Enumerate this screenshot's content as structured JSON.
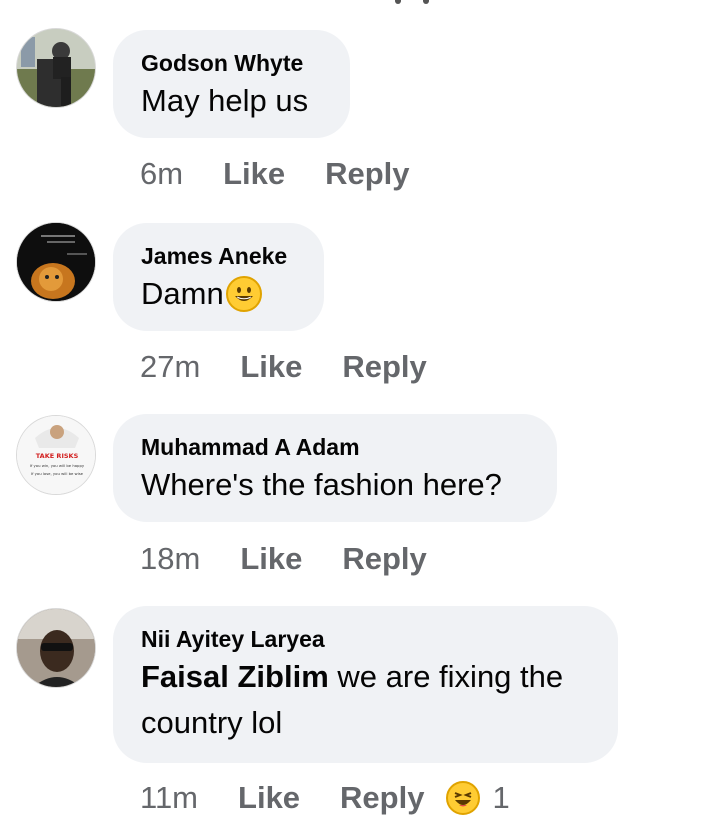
{
  "comments": [
    {
      "author": "Godson Whyte",
      "text": "May help us",
      "time": "6m",
      "like_label": "Like",
      "reply_label": "Reply"
    },
    {
      "author": "James Aneke",
      "text": "Damn",
      "emoji": "grinning-face-emoji",
      "time": "27m",
      "like_label": "Like",
      "reply_label": "Reply"
    },
    {
      "author": "Muhammad A Adam",
      "text": "Where's the fashion here?",
      "avatar_text_1": "TAKE RISKS",
      "avatar_text_2": "If you win, you will be happy",
      "avatar_text_3": "If you lose, you will be wise",
      "time": "18m",
      "like_label": "Like",
      "reply_label": "Reply"
    },
    {
      "author": "Nii Ayitey Laryea",
      "mention": "Faisal Ziblim",
      "text": " we are fixing the",
      "text_line2": "country lol",
      "time": "11m",
      "like_label": "Like",
      "reply_label": "Reply",
      "reaction": "laughing-face-emoji",
      "reaction_count": "1"
    }
  ],
  "colors": {
    "bubble": "#f0f2f5",
    "meta_text": "#65676b",
    "text": "#050505"
  }
}
